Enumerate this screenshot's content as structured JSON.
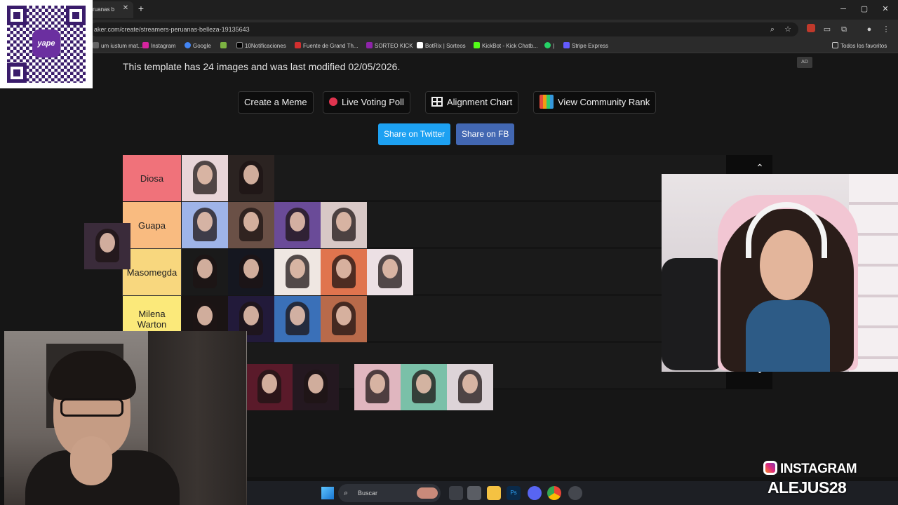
{
  "browser": {
    "tab_title": "ruanas b",
    "url": "aker.com/create/streamers-peruanas-belleza-19135643",
    "bookmarks": [
      {
        "label": "um iustum mat...",
        "color": "#666666"
      },
      {
        "label": "Instagram",
        "color": "#d6249f"
      },
      {
        "label": "Google",
        "color": "#4285f4"
      },
      {
        "label": "",
        "color": "#7cb342"
      },
      {
        "label": "10Notificaciones",
        "color": "#000000"
      },
      {
        "label": "Fuente de Grand Th...",
        "color": "#d32f2f"
      },
      {
        "label": "SORTEO KICK",
        "color": "#8e24aa"
      },
      {
        "label": "BotRix | Sorteos",
        "color": "#ffffff"
      },
      {
        "label": "KickBot - Kick Chatb...",
        "color": "#53fc18"
      },
      {
        "label": "|",
        "color": "#25d366"
      },
      {
        "label": "Stripe Express",
        "color": "#635bff"
      }
    ],
    "all_favorites": "Todos los favoritos"
  },
  "page": {
    "info_text": "This template has 24 images and was last modified 02/05/2026.",
    "ad_badge": "AD",
    "buttons": {
      "create_meme": "Create a Meme",
      "live_voting": "Live Voting Poll",
      "alignment_chart": "Alignment Chart",
      "community_rank": "View Community Rank"
    },
    "share": {
      "twitter": "Share on Twitter",
      "fb": "Share on FB",
      "twitter_color": "#1da1f2",
      "fb_color": "#4267b2"
    }
  },
  "tiers": [
    {
      "label": "Diosa",
      "color": "#f0727a",
      "thumbs": [
        "#e8d5d8",
        "#2b2321"
      ]
    },
    {
      "label": "Guapa",
      "color": "#f9bb80",
      "thumbs": [
        "#9fb4e8",
        "#6a5046",
        "#6a4b98",
        "#d8c8c6"
      ]
    },
    {
      "label": "Masomegda",
      "color": "#f8d77e",
      "thumbs": [
        "#1a1a1a",
        "#151720",
        "#efe7e2",
        "#e0744e",
        "#ece0e4"
      ]
    },
    {
      "label": "Milena\nWarton",
      "color": "#fbe97a",
      "thumbs": [
        "#1a1414",
        "#221a3a",
        "#3a70b8",
        "#b86a4a"
      ]
    },
    {
      "label": "",
      "color": "#fff47f",
      "thumbs": [
        "#b77a72"
      ]
    }
  ],
  "pool": [
    "#5a1a2a",
    "#241820",
    "#e0b6bf",
    "#7ac0a8",
    "#ddd4d8"
  ],
  "dragging_thumb": "#3a2b3a",
  "overlay": {
    "yape_label": "yape",
    "instagram": "INSTAGRAM",
    "handle": "ALEJUS28"
  },
  "taskbar": {
    "search_placeholder": "Buscar"
  }
}
